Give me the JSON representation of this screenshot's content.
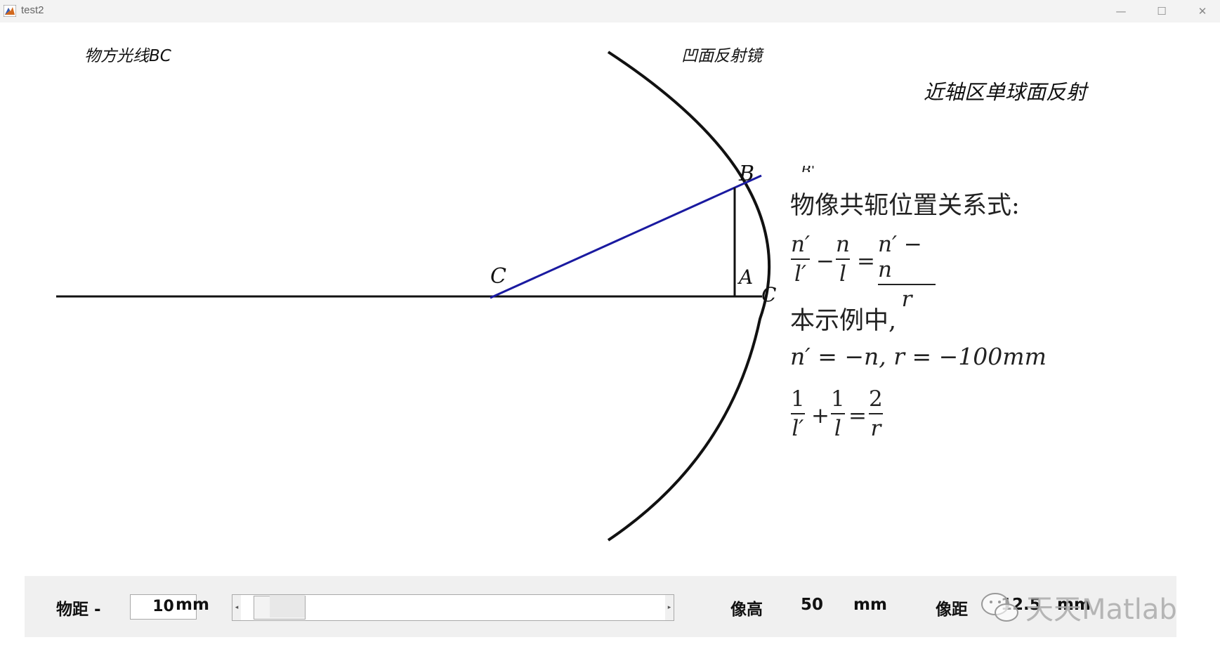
{
  "window": {
    "title": "test2",
    "minimize": "—",
    "maximize": "☐",
    "close": "✕"
  },
  "plot": {
    "label_ray": "物方光线BC",
    "label_mirror": "凹面反射镜",
    "label_heading": "近轴区单球面反射",
    "point_C_left": "C",
    "point_B": "B",
    "point_A": "A",
    "point_C_right": "C",
    "point_B_prime_partial": "B'",
    "colors": {
      "ray": "#1a1aa0",
      "mirror": "#111111",
      "axis": "#111111"
    }
  },
  "equations": {
    "line1": "物像共轭位置关系式:",
    "formula1": {
      "num1": "n′",
      "den1": "l′",
      "minus": "−",
      "num2": "n",
      "den2": "l",
      "equals": "=",
      "num3": "n′ − n",
      "den3": "r"
    },
    "line3": "本示例中,",
    "line4": "n′ = −n,  r = −100mm",
    "formula2": {
      "num1": "1",
      "den1": "l′",
      "plus": "+",
      "num2": "1",
      "den2": "l",
      "equals": "=",
      "num3": "2",
      "den3": "r"
    }
  },
  "controls": {
    "object_distance_label": "物距 -",
    "object_distance_value": "10",
    "object_distance_unit": "mm",
    "slider_left_arrow": "◂",
    "slider_right_arrow": "▸",
    "slider_level": 0.03,
    "image_height_label": "像高",
    "image_height_value": "50",
    "image_height_unit": "mm",
    "image_distance_label": "像距",
    "image_distance_value": "12.5",
    "image_distance_unit": "mm"
  },
  "watermark": {
    "text": "天天Matlab",
    "icon": "wechat-icon"
  }
}
